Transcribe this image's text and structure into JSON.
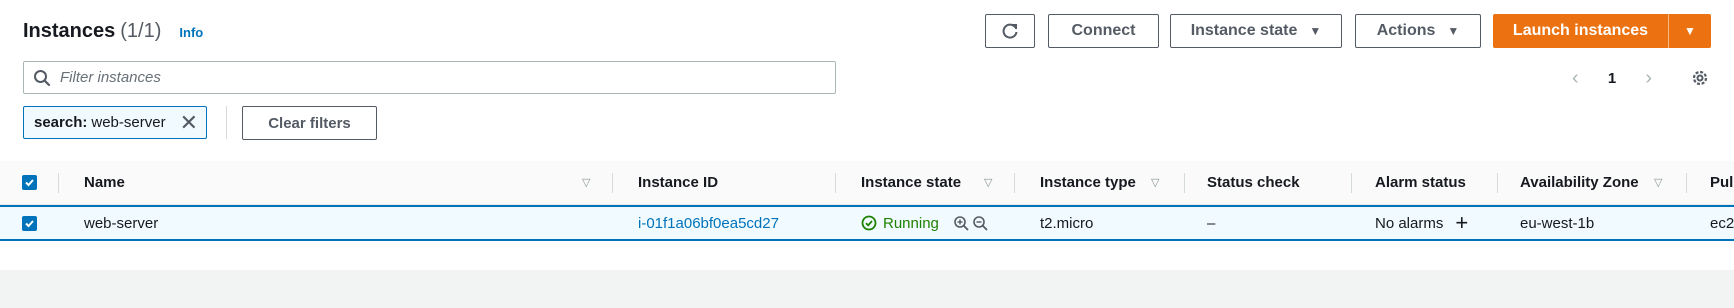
{
  "header": {
    "title": "Instances",
    "count": "(1/1)",
    "info": "Info"
  },
  "toolbar": {
    "connect": "Connect",
    "instance_state": "Instance state",
    "actions": "Actions",
    "launch": "Launch instances"
  },
  "search": {
    "placeholder": "Filter instances",
    "value": ""
  },
  "pagination": {
    "page": "1"
  },
  "filter_token": {
    "key": "search:",
    "value": "web-server"
  },
  "clear_filters": "Clear filters",
  "table": {
    "columns": [
      "Name",
      "Instance ID",
      "Instance state",
      "Instance type",
      "Status check",
      "Alarm status",
      "Availability Zone",
      "Pul"
    ],
    "rows": [
      {
        "selected": true,
        "name": "web-server",
        "instance_id": "i-01f1a06bf0ea5cd27",
        "state": "Running",
        "type": "t2.micro",
        "status_check": "–",
        "alarm": "No alarms",
        "az": "eu-west-1b",
        "public": "ec2"
      }
    ]
  },
  "colors": {
    "accent": "#0073bb",
    "launch": "#ec7211",
    "running": "#1d8102"
  }
}
